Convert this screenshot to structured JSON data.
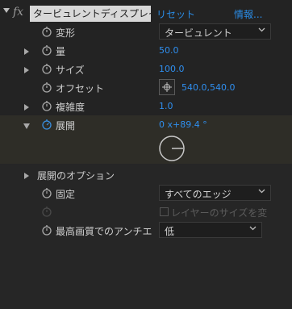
{
  "effect_header": {
    "name": "タービュレントディスプレイス",
    "reset": "リセット",
    "about": "情報..."
  },
  "properties": {
    "displacement": {
      "label": "変形",
      "value": "タービュレント"
    },
    "amount": {
      "label": "量",
      "value": "50.0"
    },
    "size": {
      "label": "サイズ",
      "value": "100.0"
    },
    "offset": {
      "label": "オフセット",
      "value": "540.0,540.0"
    },
    "complexity": {
      "label": "複雑度",
      "value": "1.0"
    },
    "evolution": {
      "label": "展開",
      "value": "0 x+89.4 °",
      "angle_deg": 89.4
    },
    "evolution_options": {
      "label": "展開のオプション"
    },
    "pinning": {
      "label": "固定",
      "value": "すべてのエッジ"
    },
    "resize_layer": {
      "label": "レイヤーのサイズを変",
      "checked": false
    },
    "antialias": {
      "label": "最高画質でのアンチエ",
      "value": "低"
    }
  },
  "colors": {
    "panel_bg": "#232323",
    "value_blue": "#2f8ff0",
    "stopwatch_blue": "#3a8fe0",
    "evolution_highlight": "#2e2d27",
    "options_bg": "#262626"
  }
}
